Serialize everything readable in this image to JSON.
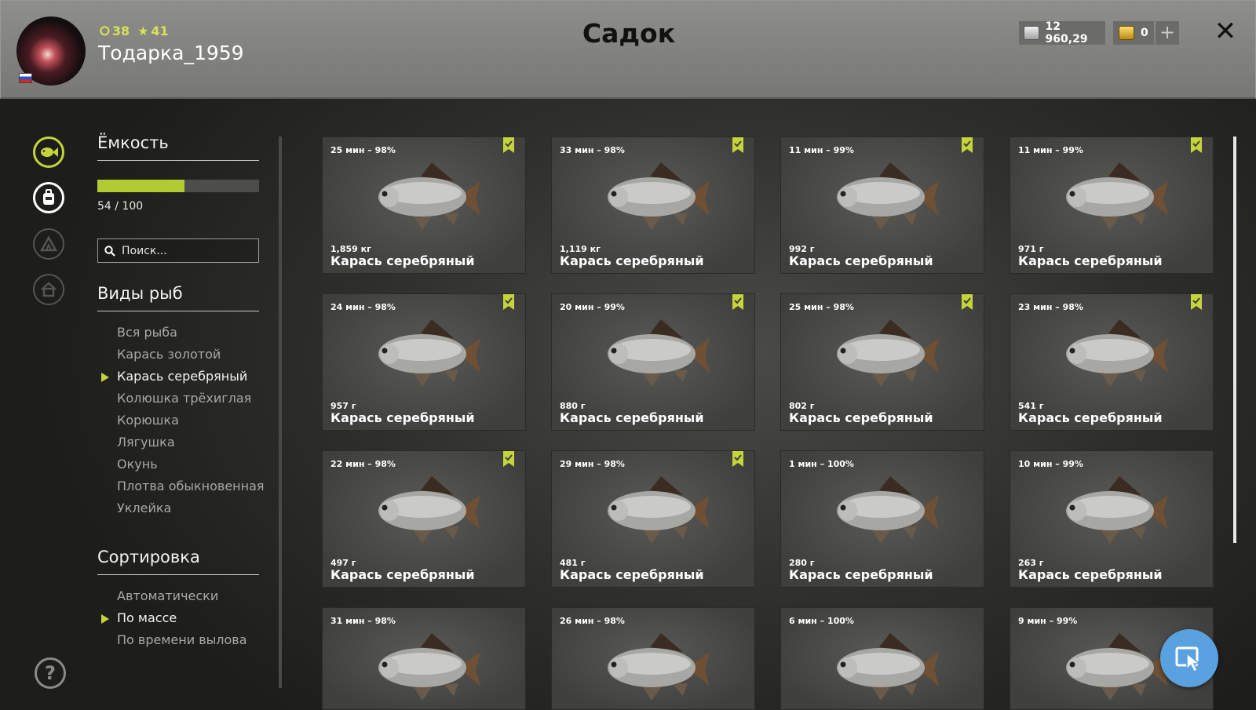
{
  "header": {
    "title": "Садок",
    "username": "Тодарка_1959",
    "level": "38",
    "rank": "41",
    "silver": "12 960,29",
    "gold": "0",
    "add_label": "+",
    "close_label": "✕"
  },
  "sidebar": {
    "capacity_title": "Ёмкость",
    "capacity_used": 54,
    "capacity_max": 100,
    "capacity_text": "54 / 100",
    "search_placeholder": "Поиск...",
    "species_title": "Виды рыб",
    "species": [
      "Вся рыба",
      "Карась золотой",
      "Карась серебряный",
      "Колюшка трёхиглая",
      "Корюшка",
      "Лягушка",
      "Окунь",
      "Плотва обыкновенная",
      "Уклейка"
    ],
    "selected_species": "Карась серебряный",
    "sort_title": "Сортировка",
    "sort_options": [
      "Автоматически",
      "По массе",
      "По времени вылова"
    ],
    "selected_sort": "По массе",
    "help_label": "?"
  },
  "fish": [
    {
      "time": "25 мин – 98%",
      "weight": "1,859 кг",
      "name": "Карась серебряный",
      "marked": true
    },
    {
      "time": "33 мин – 98%",
      "weight": "1,119 кг",
      "name": "Карась серебряный",
      "marked": true
    },
    {
      "time": "11 мин – 99%",
      "weight": "992 г",
      "name": "Карась серебряный",
      "marked": true
    },
    {
      "time": "11 мин – 99%",
      "weight": "971 г",
      "name": "Карась серебряный",
      "marked": true
    },
    {
      "time": "24 мин – 98%",
      "weight": "957 г",
      "name": "Карась серебряный",
      "marked": true
    },
    {
      "time": "20 мин – 99%",
      "weight": "880 г",
      "name": "Карась серебряный",
      "marked": true
    },
    {
      "time": "25 мин – 98%",
      "weight": "802 г",
      "name": "Карась серебряный",
      "marked": true
    },
    {
      "time": "23 мин – 98%",
      "weight": "541 г",
      "name": "Карась серебряный",
      "marked": true
    },
    {
      "time": "22 мин – 98%",
      "weight": "497 г",
      "name": "Карась серебряный",
      "marked": true
    },
    {
      "time": "29 мин – 98%",
      "weight": "481 г",
      "name": "Карась серебряный",
      "marked": true
    },
    {
      "time": "1 мин – 100%",
      "weight": "280 г",
      "name": "Карась серебряный",
      "marked": false
    },
    {
      "time": "10 мин – 99%",
      "weight": "263 г",
      "name": "Карась серебряный",
      "marked": false
    },
    {
      "time": "31 мин – 98%",
      "weight": "",
      "name": "",
      "marked": false
    },
    {
      "time": "26 мин – 98%",
      "weight": "",
      "name": "",
      "marked": false
    },
    {
      "time": "6 мин – 100%",
      "weight": "",
      "name": "",
      "marked": false
    },
    {
      "time": "9 мин – 99%",
      "weight": "",
      "name": "",
      "marked": false
    }
  ],
  "colors": {
    "accent": "#c4d43a",
    "capacity_fill": "#b3cb32",
    "fab": "#5aa2df"
  }
}
